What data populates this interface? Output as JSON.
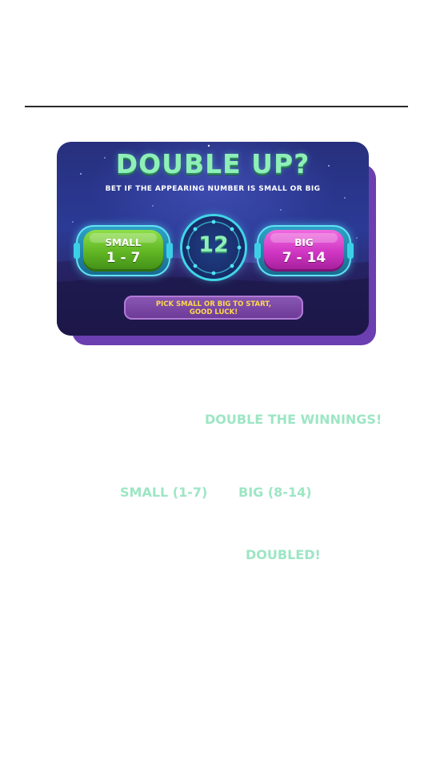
{
  "game": {
    "title": "DOUBLE UP?",
    "subtitle": "BET IF THE APPEARING NUMBER IS SMALL OR BIG",
    "small_button": {
      "label": "SMALL",
      "range": "1 - 7"
    },
    "big_button": {
      "label": "BIG",
      "range": "7 - 14"
    },
    "current_number": "12",
    "hint_line1": "PICK SMALL OR BIG TO START,",
    "hint_line2": "GOOD LUCK!"
  },
  "article": {
    "highlight_1": "DOUBLE THE WINNINGS!",
    "highlight_small": "SMALL (1-7)",
    "highlight_big": "BIG (8-14)",
    "highlight_doubled": "DOUBLED!"
  },
  "colors": {
    "title": "#8ef0b6",
    "small_button": "#5fb423",
    "big_button": "#cf35c2",
    "highlight_text": "#9de6c4",
    "panel_shadow": "#6b3fb0",
    "hint_text": "#ffd84a"
  }
}
